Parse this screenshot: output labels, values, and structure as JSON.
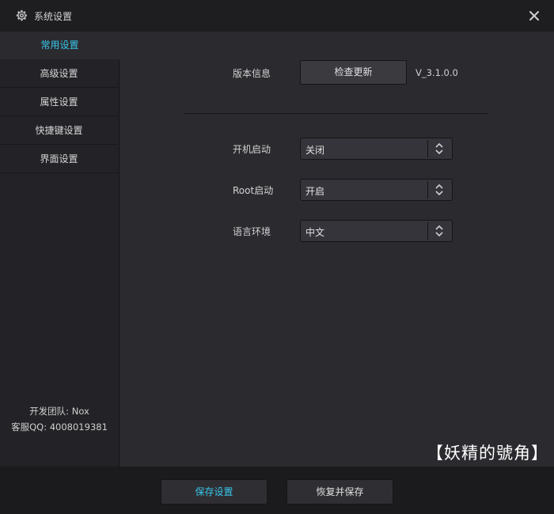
{
  "window": {
    "title": "系统设置"
  },
  "sidebar": {
    "items": [
      {
        "label": "常用设置"
      },
      {
        "label": "高级设置"
      },
      {
        "label": "属性设置"
      },
      {
        "label": "快捷键设置"
      },
      {
        "label": "界面设置"
      }
    ],
    "active_index": 0,
    "team_line": "开发团队: Nox",
    "qq_line": "客服QQ: 4008019381"
  },
  "main": {
    "version_label": "版本信息",
    "check_update_button": "检查更新",
    "version_value": "V_3.1.0.0",
    "boot_label": "开机启动",
    "boot_value": "关闭",
    "root_label": "Root启动",
    "root_value": "开启",
    "lang_label": "语言环境",
    "lang_value": "中文"
  },
  "footer": {
    "save_button": "保存设置",
    "restore_button": "恢复并保存"
  },
  "watermark": "【妖精的號角】",
  "colors": {
    "accent": "#39c6ec",
    "background": "#2b2b2f",
    "sidebar": "#232327"
  }
}
